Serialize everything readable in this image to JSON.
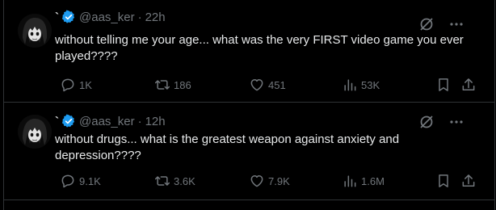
{
  "tweets": [
    {
      "name": "`",
      "handle": "@aas_ker",
      "separator": "·",
      "time": "22h",
      "text": "without telling me your age... what was the very FIRST video game you ever played????",
      "replies": "1K",
      "reposts": "186",
      "likes": "451",
      "views": "53K"
    },
    {
      "name": "`",
      "handle": "@aas_ker",
      "separator": "·",
      "time": "12h",
      "text": "without drugs... what is the greatest weapon against anxiety and depression????",
      "replies": "9.1K",
      "reposts": "3.6K",
      "likes": "7.9K",
      "views": "1.6M"
    }
  ],
  "icons": {
    "verified": "verified-badge-icon",
    "grok": "grok-icon",
    "more": "more-icon",
    "reply": "reply-icon",
    "repost": "repost-icon",
    "like": "like-icon",
    "views": "views-icon",
    "bookmark": "bookmark-icon",
    "share": "share-icon"
  },
  "colors": {
    "background": "#000000",
    "text": "#e7e9ea",
    "muted": "#71767b",
    "verified": "#1d9bf0",
    "divider": "#2f3336"
  }
}
